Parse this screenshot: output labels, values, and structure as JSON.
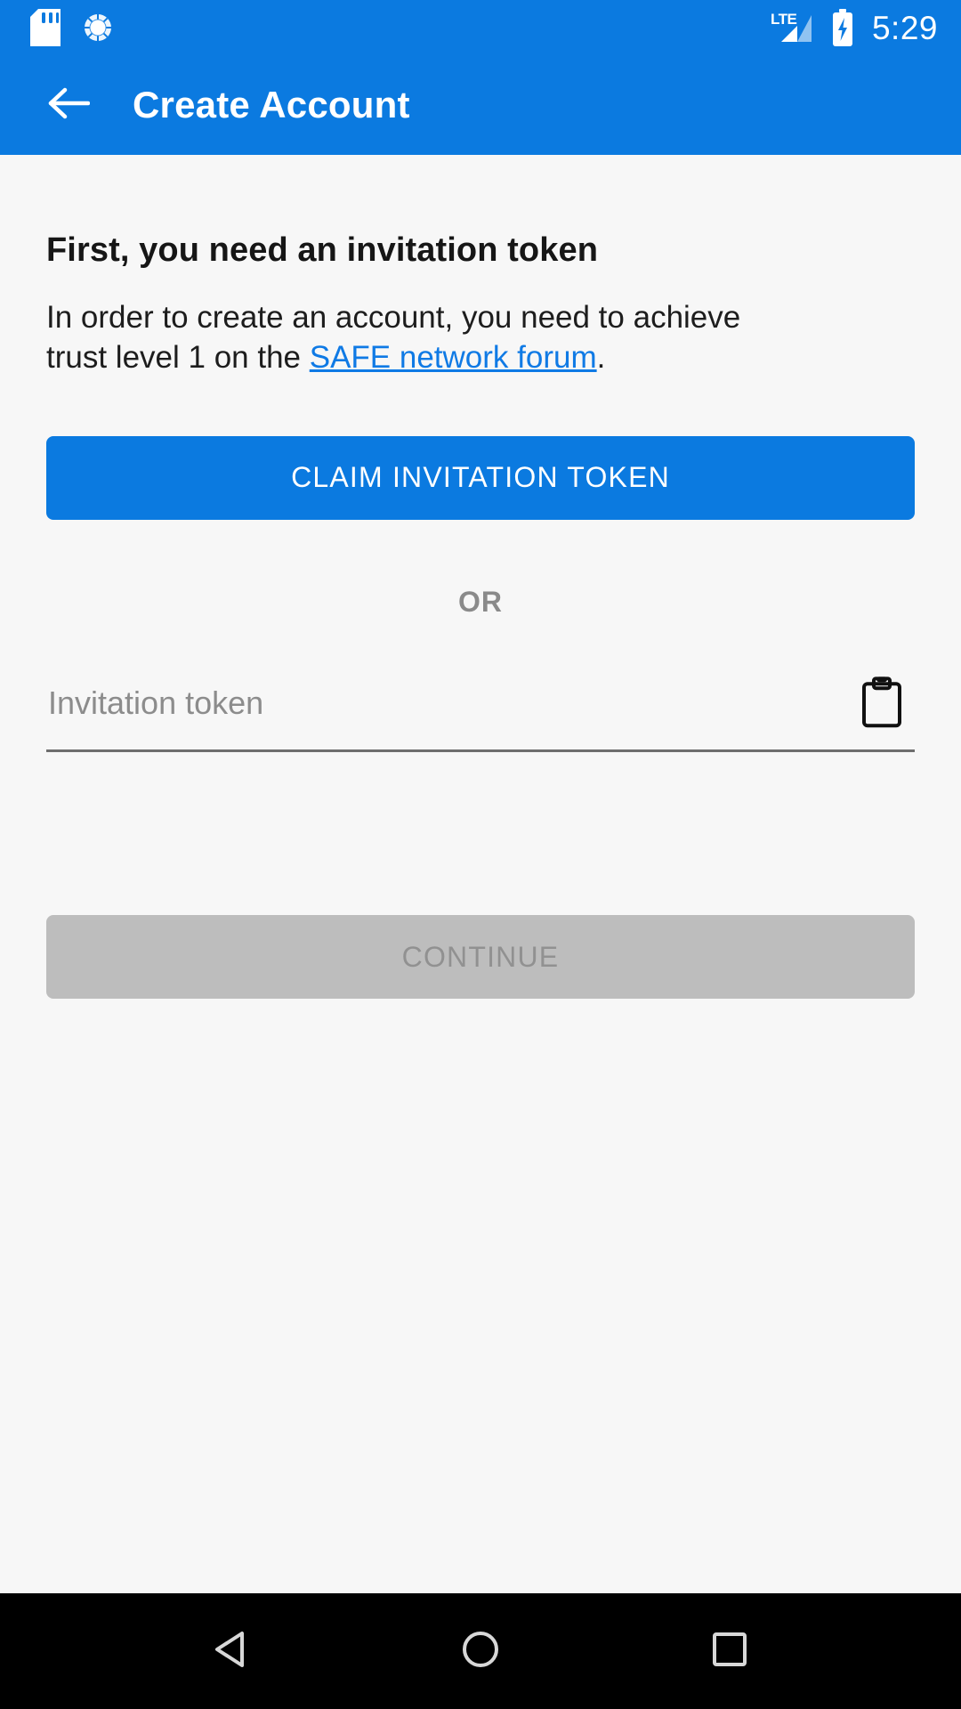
{
  "status_bar": {
    "time": "5:29",
    "network_label": "LTE",
    "icons": [
      "sd-card-icon",
      "sync-circle-icon",
      "lte-signal-icon",
      "battery-charging-icon"
    ],
    "background_color": "#0b7ae0",
    "foreground_color": "#ffffff"
  },
  "app_bar": {
    "title": "Create Account",
    "back_icon": "arrow-back-icon",
    "background_color": "#0b7ae0"
  },
  "main": {
    "heading": "First, you need an invitation token",
    "paragraph": {
      "before_link": "In order to create an account, you need to achieve trust level 1 on the ",
      "link_text": "SAFE network forum",
      "after_link": "."
    },
    "claim_button_label": "CLAIM INVITATION TOKEN",
    "divider_label": "OR",
    "token_field": {
      "placeholder": "Invitation token",
      "value": "",
      "paste_icon": "clipboard-paste-icon"
    },
    "continue_button_label": "CONTINUE",
    "continue_button_enabled": "false",
    "accent_color": "#0b7ae0",
    "link_color": "#0f7ae5",
    "disabled_button_color": "#bdbdbd",
    "disabled_button_text_color": "#919191",
    "background_color": "#f7f7f7"
  },
  "nav_bar": {
    "background_color": "#000000",
    "buttons": [
      {
        "name": "back",
        "icon": "triangle-back-icon"
      },
      {
        "name": "home",
        "icon": "circle-home-icon"
      },
      {
        "name": "recents",
        "icon": "square-recents-icon"
      }
    ]
  }
}
